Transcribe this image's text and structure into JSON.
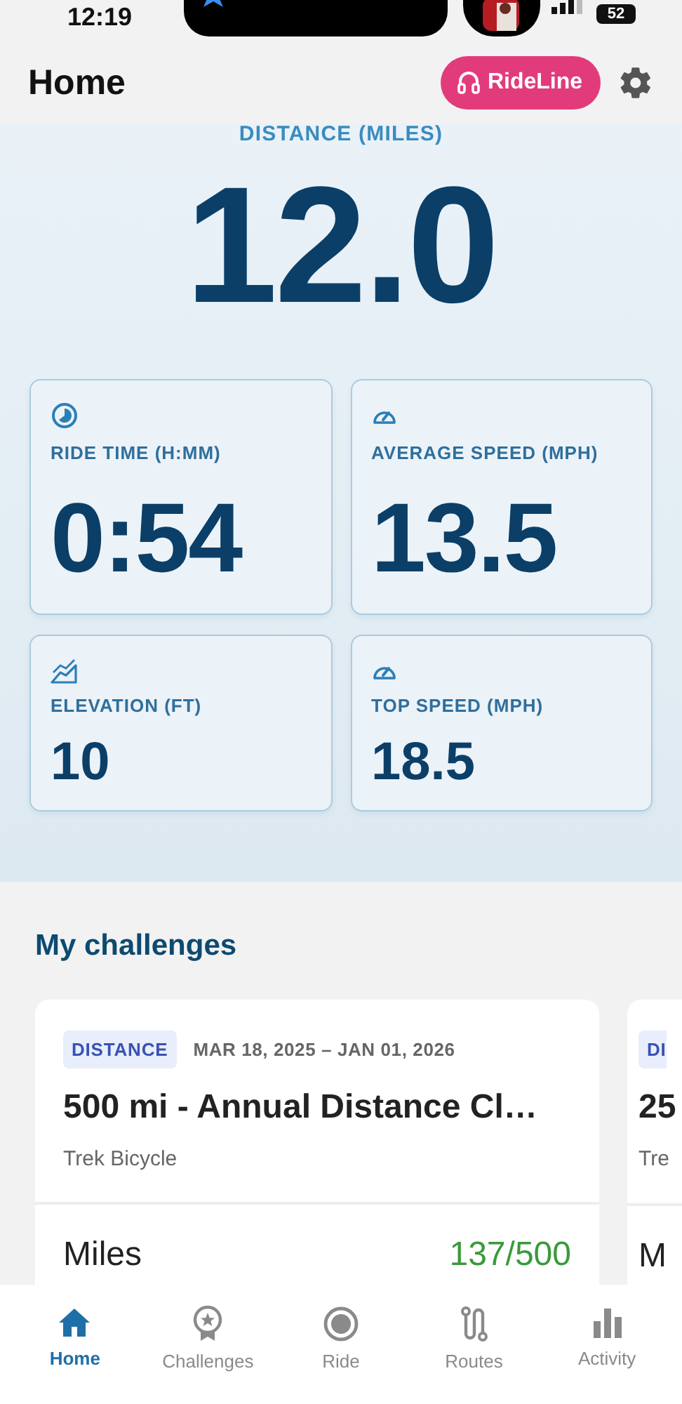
{
  "status_bar": {
    "time": "12:19",
    "battery": "52"
  },
  "header": {
    "title": "Home",
    "rideline_button": "RideLine"
  },
  "distance": {
    "label": "DISTANCE (MILES)",
    "value": "12.0"
  },
  "stats": [
    {
      "label": "RIDE TIME (H:MM)",
      "value": "0:54",
      "kind": "large"
    },
    {
      "label": "AVERAGE SPEED (MPH)",
      "value": "13.5",
      "kind": "large"
    },
    {
      "label": "ELEVATION (FT)",
      "value": "10",
      "kind": "small"
    },
    {
      "label": "TOP SPEED (MPH)",
      "value": "18.5",
      "kind": "small"
    }
  ],
  "challenges": {
    "title": "My challenges",
    "cards": [
      {
        "tag": "DISTANCE",
        "dates": "MAR 18, 2025 – JAN 01, 2026",
        "name": "500 mi - Annual Distance Cl…",
        "sponsor": "Trek Bicycle",
        "metric": "Miles",
        "progress": "137/500"
      },
      {
        "tag": "DI",
        "name": "25",
        "sponsor": "Tre",
        "metric": "M"
      }
    ]
  },
  "nav": [
    {
      "label": "Home",
      "selected": true
    },
    {
      "label": "Challenges",
      "selected": false
    },
    {
      "label": "Ride",
      "selected": false
    },
    {
      "label": "Routes",
      "selected": false
    },
    {
      "label": "Activity",
      "selected": false
    }
  ]
}
